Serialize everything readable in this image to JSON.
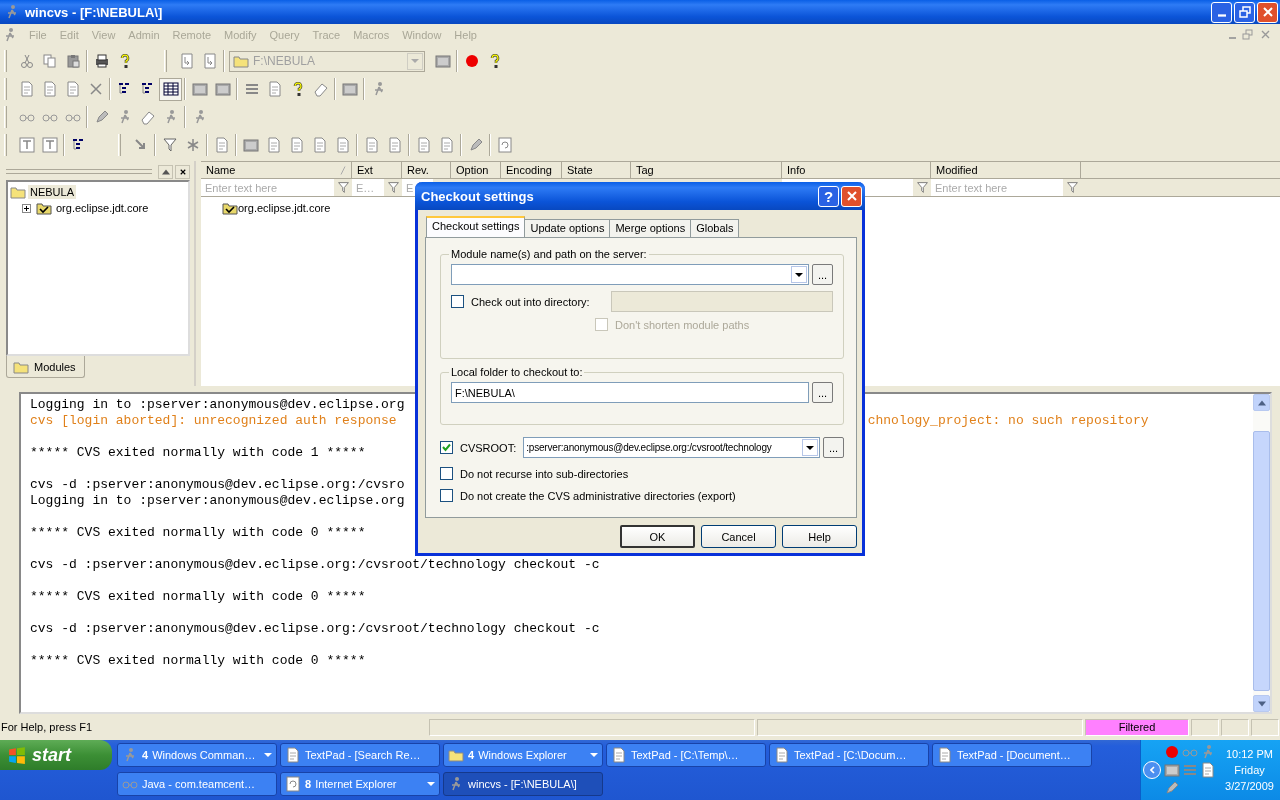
{
  "window": {
    "title": "wincvs - [F:\\NEBULA\\]"
  },
  "menu": [
    {
      "label": "File",
      "disabled": true
    },
    {
      "label": "Edit",
      "disabled": true
    },
    {
      "label": "View",
      "disabled": true
    },
    {
      "label": "Admin",
      "disabled": true
    },
    {
      "label": "Remote",
      "disabled": true
    },
    {
      "label": "Modify",
      "disabled": true
    },
    {
      "label": "Query",
      "disabled": true
    },
    {
      "label": "Trace",
      "disabled": true
    },
    {
      "label": "Macros",
      "disabled": true
    },
    {
      "label": "Window",
      "disabled": true
    },
    {
      "label": "Help",
      "disabled": true
    }
  ],
  "toolbar": {
    "path_combo": "F:\\NEBULA"
  },
  "modules_pane": {
    "tree": [
      {
        "label": "NEBULA",
        "selected": true,
        "expanded": true,
        "children": [
          {
            "label": "org.eclipse.jdt.core",
            "selected": false,
            "expanded": false
          }
        ]
      }
    ],
    "tab": "Modules"
  },
  "file_list": {
    "columns": [
      {
        "label": "Name",
        "sorted": true,
        "filter": true,
        "filter_placeholder": "Enter text here"
      },
      {
        "label": "Ext",
        "sorted": false,
        "filter": true,
        "filter_placeholder": "E…"
      },
      {
        "label": "Rev.",
        "sorted": false,
        "filter": true,
        "filter_placeholder": "E"
      },
      {
        "label": "Option",
        "sorted": false
      },
      {
        "label": "Encoding",
        "sorted": false
      },
      {
        "label": "State",
        "sorted": false
      },
      {
        "label": "Tag",
        "sorted": false
      },
      {
        "label": "Info",
        "sorted": false,
        "filter": true
      },
      {
        "label": "Modified",
        "sorted": false,
        "filter": true,
        "filter_placeholder": "Enter text here"
      }
    ],
    "rows": [
      {
        "name": "org.eclipse.jdt.core"
      }
    ]
  },
  "log": {
    "blocks": [
      [
        {
          "text": "Logging in to :pserver:anonymous@dev.eclipse.org",
          "kind": "info"
        },
        {
          "text": "cvs [login aborted]: unrecognized auth response",
          "kind": "error",
          "tail": "chnology_project: no such repository"
        }
      ],
      [
        {
          "text": "***** CVS exited normally with code 1 *****",
          "kind": "info"
        }
      ],
      [
        {
          "text": "cvs -d :pserver:anonymous@dev.eclipse.org:/cvsro",
          "kind": "info"
        },
        {
          "text": "Logging in to :pserver:anonymous@dev.eclipse.org",
          "kind": "info"
        }
      ],
      [
        {
          "text": "***** CVS exited normally with code 0 *****",
          "kind": "info"
        }
      ],
      [
        {
          "text": "cvs -d :pserver:anonymous@dev.eclipse.org:/cvsroot/technology checkout -c",
          "kind": "info"
        }
      ],
      [
        {
          "text": "***** CVS exited normally with code 0 *****",
          "kind": "info"
        }
      ],
      [
        {
          "text": "cvs -d :pserver:anonymous@dev.eclipse.org:/cvsroot/technology checkout -c",
          "kind": "info"
        }
      ],
      [
        {
          "text": "***** CVS exited normally with code 0 *****",
          "kind": "info"
        }
      ]
    ]
  },
  "dialog": {
    "title": "Checkout settings",
    "help_glyph": "?",
    "tabs": [
      {
        "label": "Checkout settings",
        "selected": true
      },
      {
        "label": "Update options",
        "selected": false
      },
      {
        "label": "Merge options",
        "selected": false
      },
      {
        "label": "Globals",
        "selected": false
      }
    ],
    "module_group": {
      "label": "Module name(s) and path on the server:",
      "browse": "...",
      "checkout_dir": {
        "label": "Check out into directory:",
        "checked": false
      },
      "no_shorten": {
        "label": "Don't shorten module paths",
        "checked": false,
        "disabled": true
      }
    },
    "local_group": {
      "label": "Local folder to checkout to:",
      "value": "F:\\NEBULA\\",
      "browse": "..."
    },
    "cvsroot": {
      "label": "CVSROOT:",
      "checked": true,
      "value": ":pserver:anonymous@dev.eclipse.org:/cvsroot/technology",
      "browse": "..."
    },
    "options": [
      {
        "label": "Do not recurse into sub-directories",
        "checked": false
      },
      {
        "label": "Do not create the CVS administrative directories (export)",
        "checked": false
      }
    ],
    "buttons": [
      {
        "label": "OK",
        "default": true
      },
      {
        "label": "Cancel",
        "default": false
      },
      {
        "label": "Help",
        "default": false
      }
    ]
  },
  "status_bar": {
    "help": "For Help, press F1",
    "filter_state": "Filtered"
  },
  "taskbar": {
    "start": "start",
    "rows": [
      [
        {
          "count": "4",
          "label": "Windows Comman…",
          "group": true,
          "selected": false
        },
        {
          "label": "TextPad - [Search Re…",
          "group": false,
          "selected": false
        },
        {
          "count": "4",
          "label": "Windows Explorer",
          "group": true,
          "selected": false
        },
        {
          "label": "TextPad - [C:\\Temp\\…",
          "group": false,
          "selected": false
        },
        {
          "label": "TextPad - [C:\\Docum…",
          "group": false,
          "selected": false
        },
        {
          "label": "TextPad - [Document…",
          "group": false,
          "selected": false
        }
      ],
      [
        {
          "label": "Java - com.teamcent…",
          "group": false,
          "selected": false
        },
        {
          "count": "8",
          "label": "Internet Explorer",
          "group": true,
          "selected": false
        },
        {
          "label": "wincvs - [F:\\NEBULA\\]",
          "group": false,
          "selected": true
        }
      ]
    ],
    "clock": {
      "time": "10:12 PM",
      "day": "Friday",
      "date": "3/27/2009"
    }
  }
}
